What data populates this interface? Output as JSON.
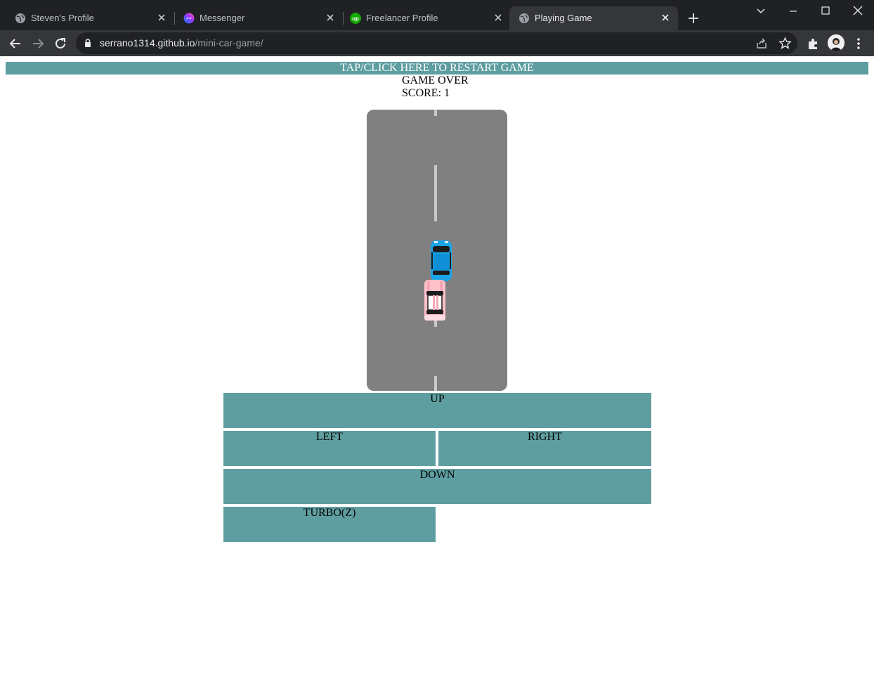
{
  "browser": {
    "tabs": [
      {
        "title": "Steven's Profile",
        "icon": "globe-icon",
        "active": false
      },
      {
        "title": "Messenger",
        "icon": "messenger-icon",
        "active": false
      },
      {
        "title": "Freelancer Profile",
        "icon": "upwork-icon",
        "active": false
      },
      {
        "title": "Playing Game",
        "icon": "globe-icon",
        "active": true
      }
    ],
    "address": {
      "host": "serrano1314.github.io",
      "path": "/mini-car-game/"
    }
  },
  "game": {
    "restart_label": "TAP/CLICK HERE TO RESTART GAME",
    "status": "GAME OVER",
    "score_text": "SCORE: 1",
    "colors": {
      "accent": "#5f9ea0",
      "road": "#808080",
      "lane_marking": "#c8c8c8",
      "player_car": "#1aa3e8",
      "enemy_car": "#ffc0cb"
    },
    "controls": {
      "up": "UP",
      "left": "LEFT",
      "right": "RIGHT",
      "down": "DOWN",
      "turbo": "TURBO(Z)"
    }
  }
}
